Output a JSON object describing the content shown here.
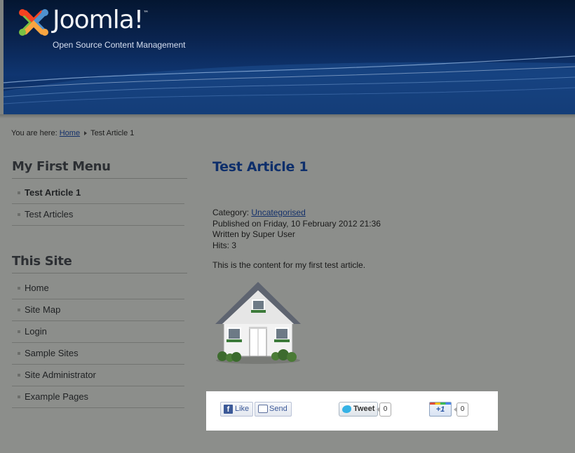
{
  "header": {
    "logo_text": "Joomla!",
    "logo_tm": "™",
    "tagline": "Open Source Content Management"
  },
  "breadcrumb": {
    "prefix": "You are here:",
    "home": "Home",
    "current": "Test Article 1"
  },
  "sidebar": {
    "menu1": {
      "title": "My First Menu",
      "items": [
        {
          "label": "Test Article 1"
        },
        {
          "label": "Test Articles"
        }
      ]
    },
    "menu2": {
      "title": "This Site",
      "items": [
        {
          "label": "Home"
        },
        {
          "label": "Site Map"
        },
        {
          "label": "Login"
        },
        {
          "label": "Sample Sites"
        },
        {
          "label": "Site Administrator"
        },
        {
          "label": "Example Pages"
        }
      ]
    }
  },
  "article": {
    "title": "Test Article 1",
    "category_label": "Category:",
    "category": "Uncategorised",
    "published": "Published on Friday, 10 February 2012 21:36",
    "author": "Written by Super User",
    "hits": "Hits: 3",
    "body": "This is the content for my first test article."
  },
  "social": {
    "fb_like": "Like",
    "fb_send": "Send",
    "tweet": "Tweet",
    "tweet_count": "0",
    "gplus": "+1",
    "gplus_count": "0"
  },
  "icons": [
    "joomla-logo-icon",
    "breadcrumb-arrow-icon",
    "menu-bullet-icon",
    "house-image",
    "facebook-icon",
    "send-icon",
    "twitter-bird-icon",
    "google-plus-icon"
  ],
  "colors": {
    "page_bg": "#8c8e8b",
    "header_bg": "#0a2450",
    "title_blue": "#0e2f6b"
  }
}
